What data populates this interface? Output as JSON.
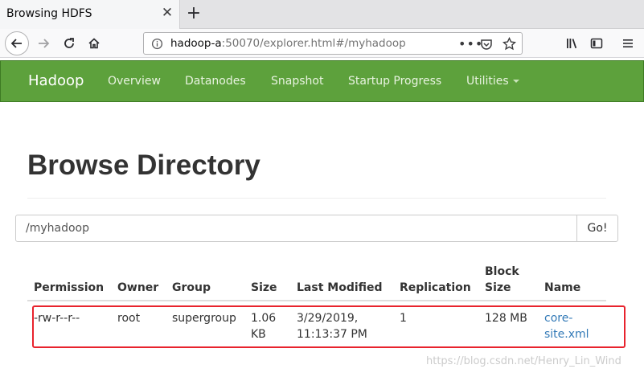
{
  "browser": {
    "tab_title": "Browsing HDFS",
    "url_host": "hadoop-a",
    "url_rest": ":50070/explorer.html#/myhadoop"
  },
  "navbar": {
    "brand": "Hadoop",
    "items": [
      "Overview",
      "Datanodes",
      "Snapshot",
      "Startup Progress",
      "Utilities"
    ]
  },
  "content": {
    "title": "Browse Directory",
    "path_value": "/myhadoop",
    "go_label": "Go!"
  },
  "table": {
    "headers": [
      "Permission",
      "Owner",
      "Group",
      "Size",
      "Last Modified",
      "Replication",
      "Block",
      "Size",
      "Name"
    ],
    "row": {
      "permission": "-rw-r--r--",
      "owner": "root",
      "group": "supergroup",
      "size_1": "1.06",
      "size_2": "KB",
      "modified_1": "3/29/2019,",
      "modified_2": "11:13:37 PM",
      "replication": "1",
      "block_size": "128 MB",
      "name_1": "core-",
      "name_2": "site.xml"
    }
  },
  "watermark": "https://blog.csdn.net/Henry_Lin_Wind",
  "colors": {
    "navbar": "#5da13c",
    "link": "#337ab7",
    "highlight": "#e8232d"
  }
}
